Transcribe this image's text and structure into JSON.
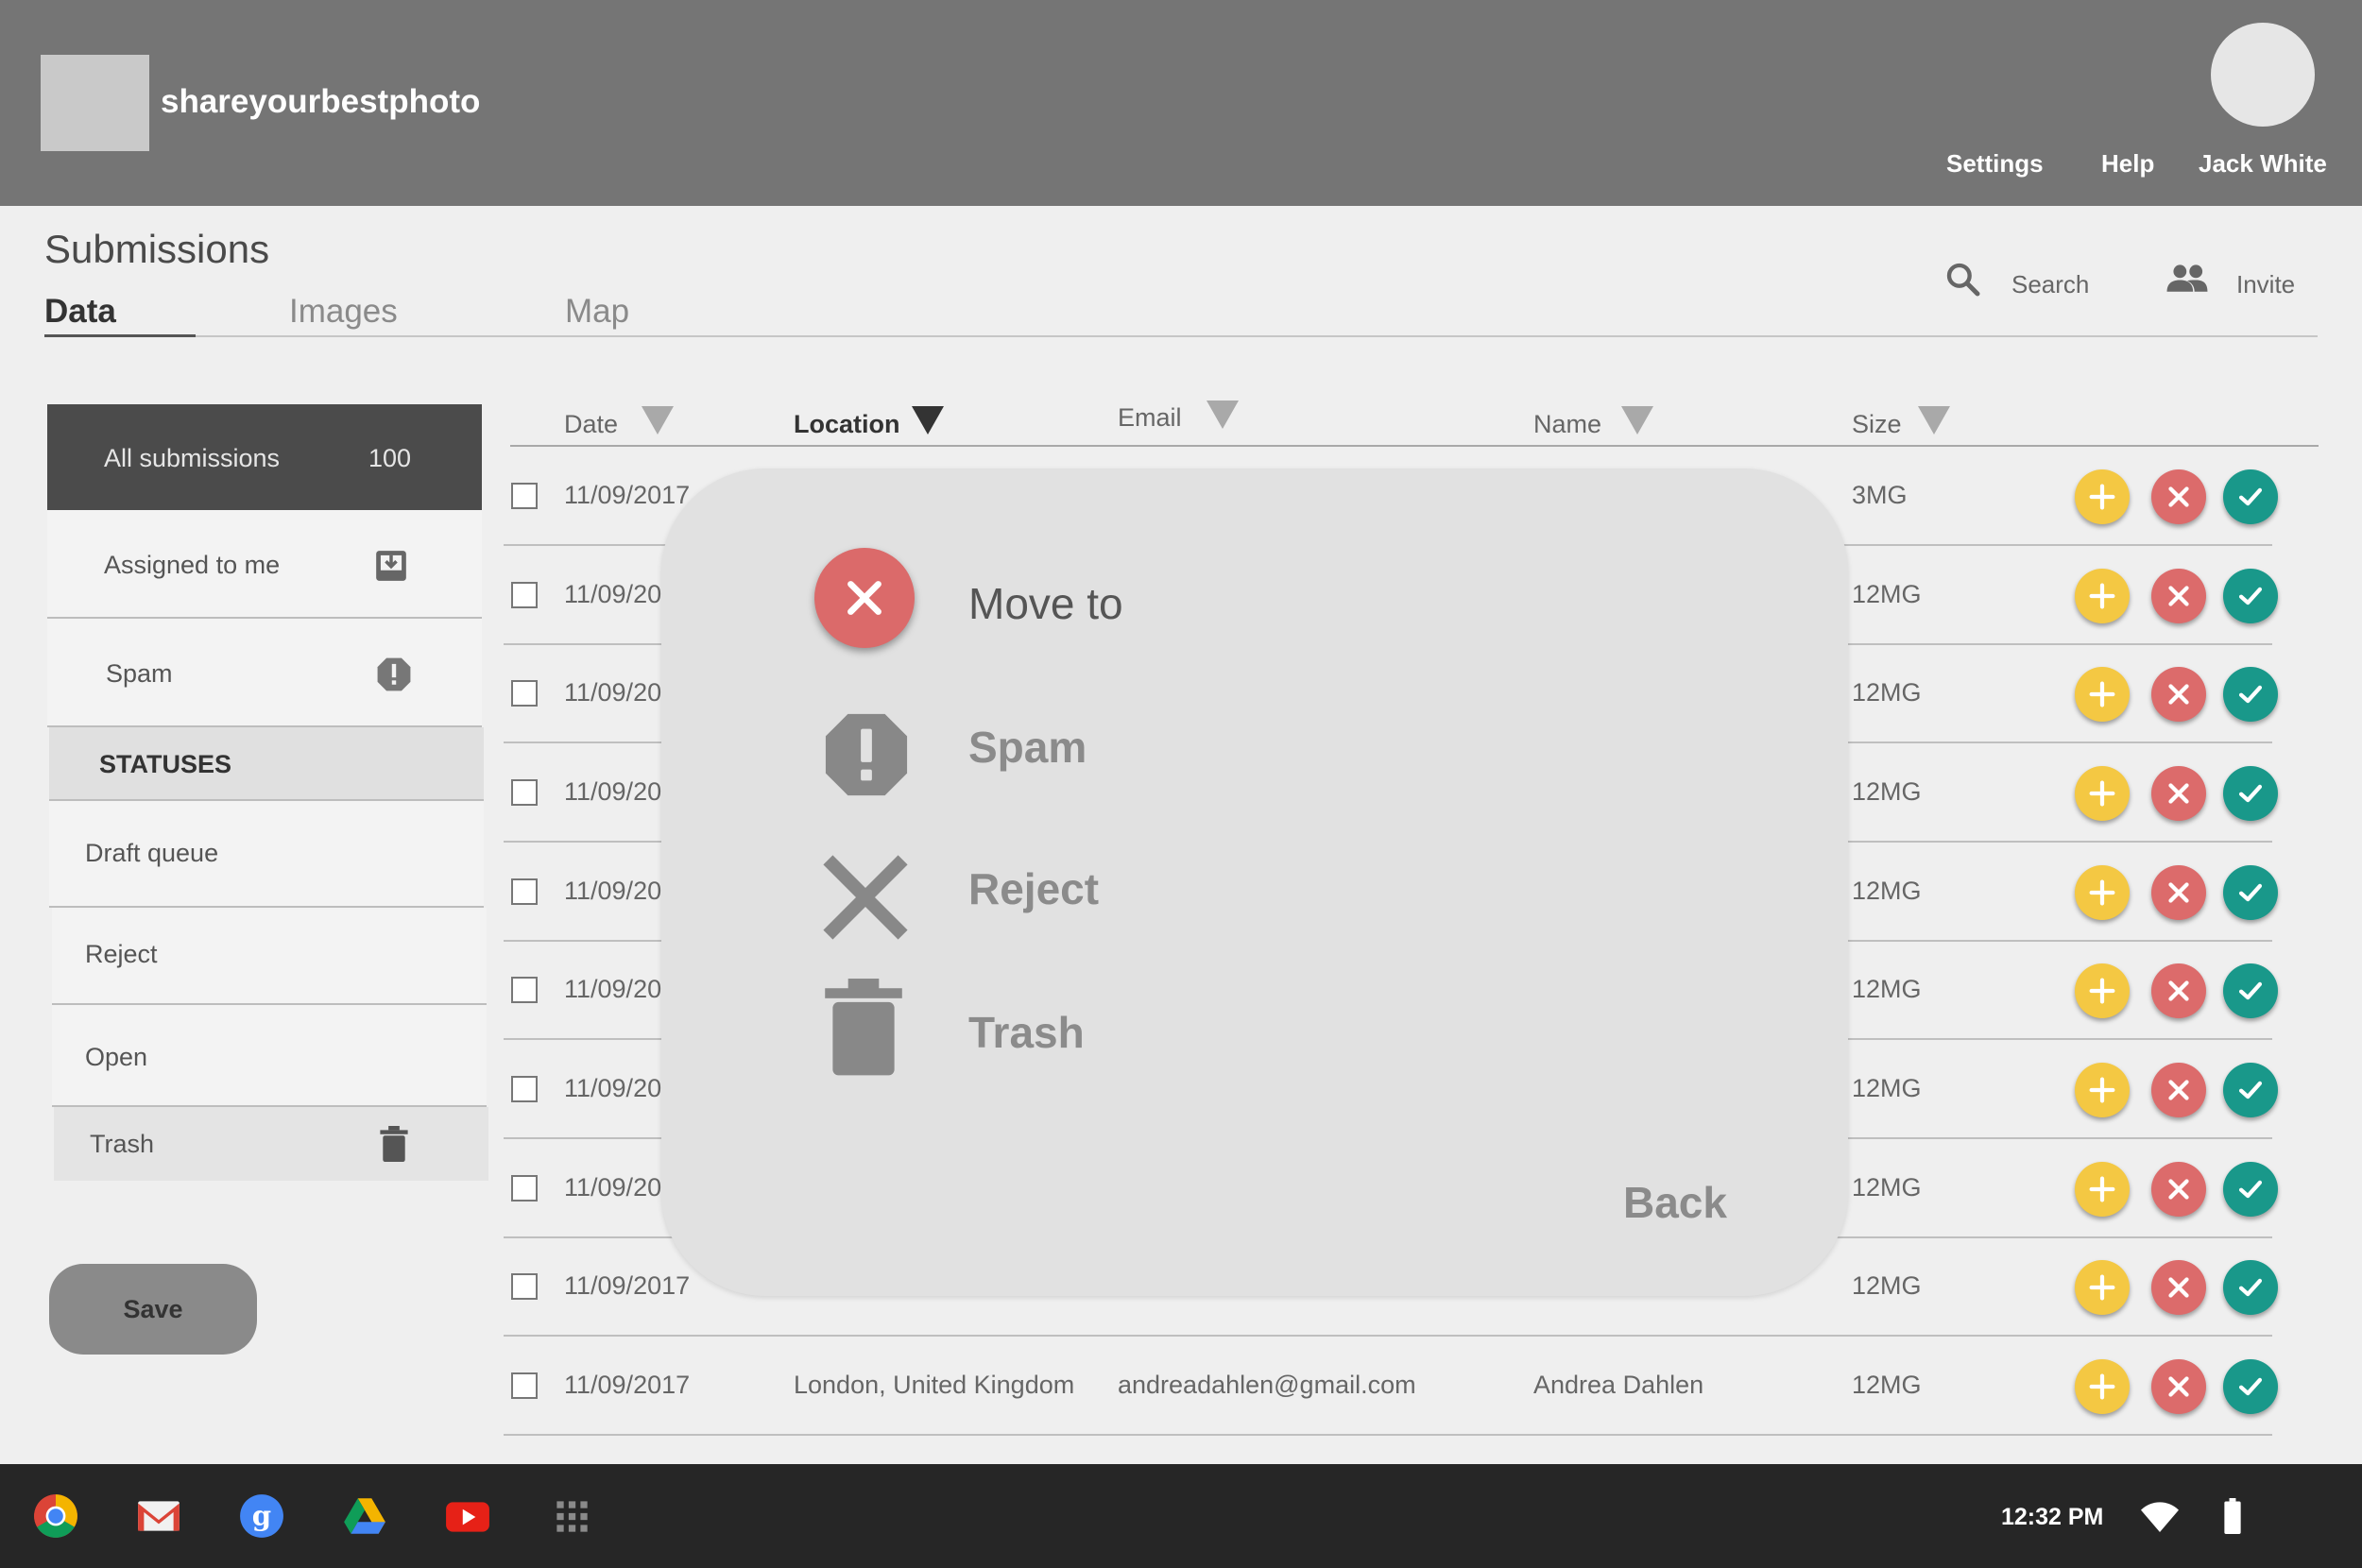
{
  "app": {
    "title": "shareyourbestphoto",
    "nav": {
      "settings": "Settings",
      "help": "Help",
      "user": "Jack White"
    }
  },
  "page": {
    "title": "Submissions",
    "tabs": [
      {
        "label": "Data",
        "active": true
      },
      {
        "label": "Images",
        "active": false
      },
      {
        "label": "Map",
        "active": false
      }
    ],
    "tools": {
      "search": "Search",
      "invite": "Invite"
    }
  },
  "sidebar": {
    "all": {
      "label": "All submissions",
      "count": "100"
    },
    "assigned": {
      "label": "Assigned to me",
      "icon": "inbox-download-icon"
    },
    "spam": {
      "label": "Spam",
      "icon": "alert-octagon-icon"
    },
    "statuses_heading": "STATUSES",
    "statuses": [
      {
        "label": "Draft queue"
      },
      {
        "label": "Reject"
      },
      {
        "label": "Open"
      },
      {
        "label": "Trash",
        "icon": "trash-icon"
      }
    ],
    "save_label": "Save"
  },
  "table": {
    "columns": [
      "Date",
      "Location",
      "Email",
      "Name",
      "Size"
    ],
    "rows": [
      {
        "date": "11/09/2017",
        "size": "3MG"
      },
      {
        "date": "11/09/2017",
        "size": "12MG"
      },
      {
        "date": "11/09/2017",
        "size": "12MG"
      },
      {
        "date": "11/09/2017",
        "size": "12MG"
      },
      {
        "date": "11/09/2017",
        "size": "12MG"
      },
      {
        "date": "11/09/2017",
        "size": "12MG"
      },
      {
        "date": "11/09/2017",
        "size": "12MG"
      },
      {
        "date": "11/09/2017",
        "size": "12MG"
      },
      {
        "date": "11/09/2017",
        "size": "12MG"
      },
      {
        "date": "11/09/2017",
        "location": "London, United Kingdom",
        "email": "andreadahlen@gmail.com",
        "name": "Andrea Dahlen",
        "size": "12MG"
      }
    ]
  },
  "modal": {
    "options": [
      {
        "label": "Move to",
        "icon": "close-circle-icon"
      },
      {
        "label": "Spam",
        "icon": "alert-octagon-icon"
      },
      {
        "label": "Reject",
        "icon": "close-icon"
      },
      {
        "label": "Trash",
        "icon": "trash-icon"
      }
    ],
    "back_label": "Back"
  },
  "taskbar": {
    "apps": [
      "chrome-icon",
      "gmail-icon",
      "google-plus-icon",
      "drive-icon",
      "youtube-icon",
      "app-launcher-icon"
    ],
    "time": "12:32 PM"
  },
  "colors": {
    "header": "#757575",
    "add": "#f4c843",
    "reject": "#dc6b6b",
    "approve": "#19988a",
    "sidebar_active": "#4b4b4b",
    "taskbar": "#262626"
  }
}
